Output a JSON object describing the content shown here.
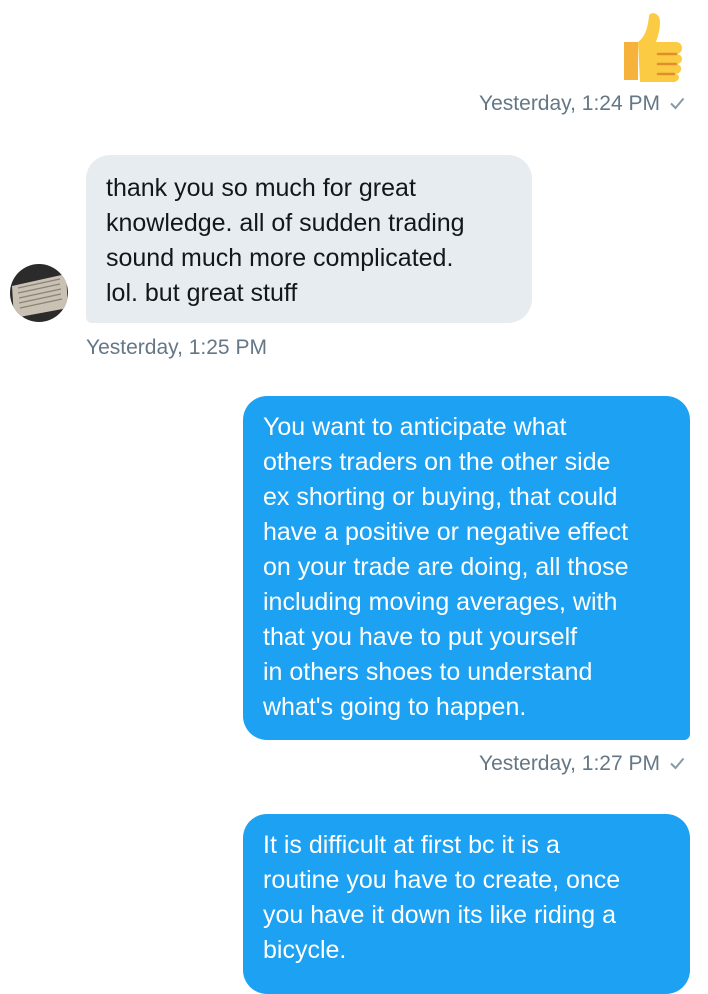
{
  "conversation": {
    "messages": [
      {
        "id": "m1",
        "direction": "outgoing",
        "type": "emoji",
        "emoji": "thumbs-up-icon",
        "timestamp": "Yesterday, 1:24 PM",
        "status": "sent-check-icon"
      },
      {
        "id": "m2",
        "direction": "incoming",
        "type": "text",
        "text": "thank you so much for great\nknowledge.  all of sudden trading\nsound much more complicated.\nlol. but great stuff",
        "timestamp": "Yesterday, 1:25 PM"
      },
      {
        "id": "m3",
        "direction": "outgoing",
        "type": "text",
        "text": "You want to anticipate what\nothers traders on the other side\nex shorting or buying, that could\nhave a positive or negative effect\non your trade are doing, all those\nincluding moving averages, with\nthat you have to put yourself\nin others shoes to understand\nwhat's going to happen.",
        "timestamp": "Yesterday, 1:27 PM",
        "status": "sent-check-icon"
      },
      {
        "id": "m4",
        "direction": "outgoing",
        "type": "text",
        "text": "It is difficult at first bc it is a\nroutine you have to create, once\nyou have it down its like riding a\nbicycle."
      }
    ]
  },
  "colors": {
    "outgoing_bubble": "#1da1f2",
    "incoming_bubble": "#e6ecf0",
    "timestamp_text": "#657786",
    "emoji_yellow": "#fccb44",
    "emoji_outline": "#e8a83a"
  }
}
